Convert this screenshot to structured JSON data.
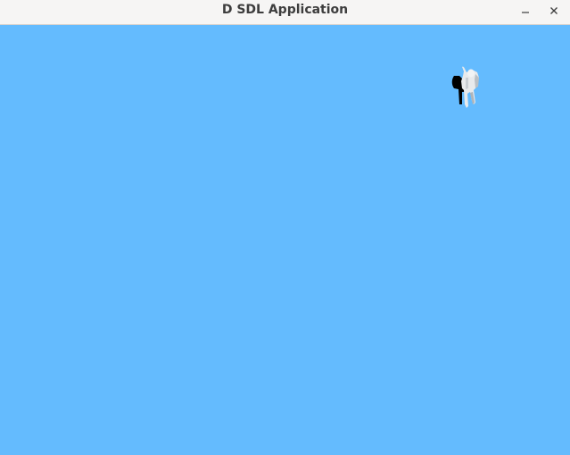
{
  "window": {
    "title": "D SDL Application",
    "controls": {
      "minimize_icon": "minimize-icon",
      "close_icon": "close-icon"
    }
  },
  "colors": {
    "titlebar_bg": "#f6f5f4",
    "title_text": "#3d3d3d",
    "viewport_bg": "#64bbfe",
    "figure_light": "#e8eaec",
    "figure_shadow": "#000000"
  },
  "scene": {
    "object": "humanoid-character"
  }
}
